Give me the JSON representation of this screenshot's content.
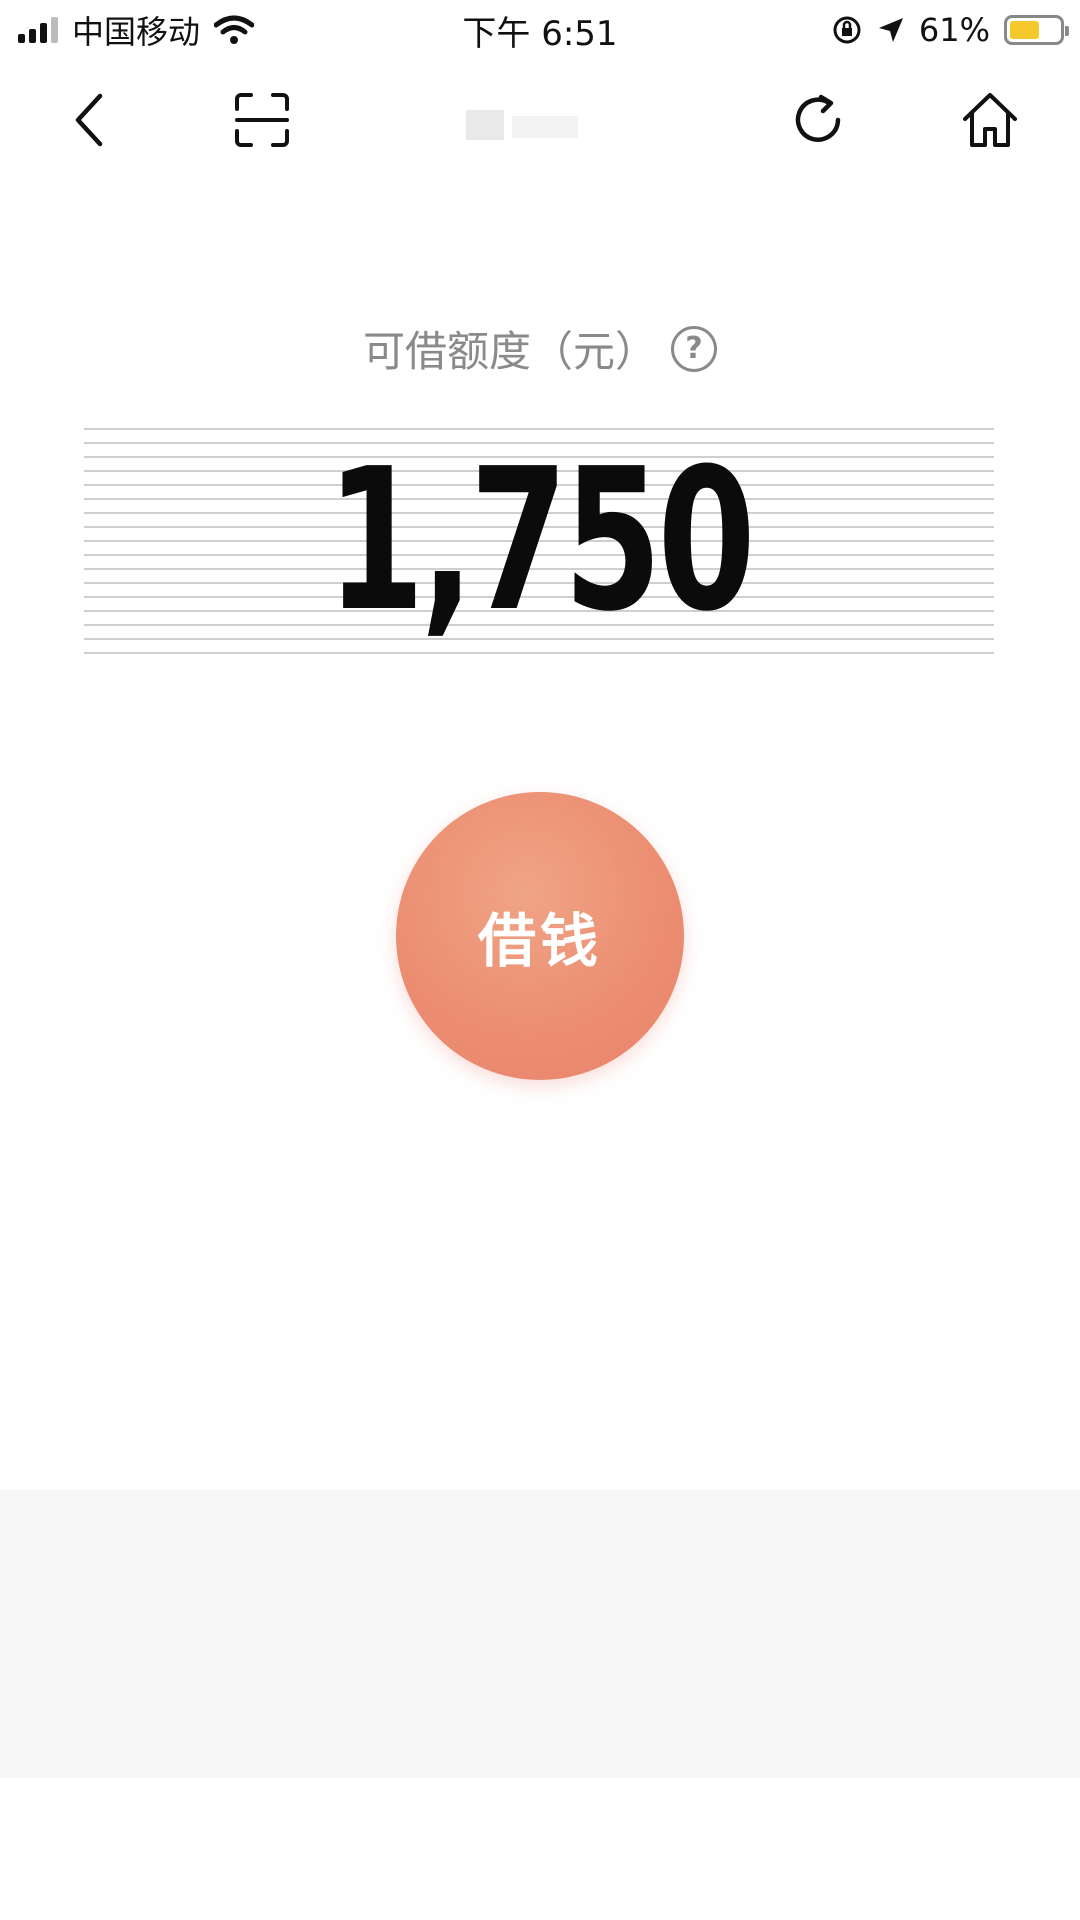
{
  "status_bar": {
    "carrier": "中国移动",
    "time": "下午 6:51",
    "battery_percent": "61%",
    "battery_level": 0.61,
    "battery_color": "#f5c82c",
    "icons": [
      "signal-icon",
      "wifi-icon",
      "orientation-lock-icon",
      "location-icon",
      "battery-icon"
    ]
  },
  "nav": {
    "icons": [
      "back-icon",
      "scan-icon",
      "refresh-icon",
      "home-icon"
    ]
  },
  "credit": {
    "label": "可借额度（元）",
    "amount": "1,750",
    "help_symbol": "?"
  },
  "borrow_button": {
    "label": "借钱",
    "color": "#ec8e72"
  }
}
